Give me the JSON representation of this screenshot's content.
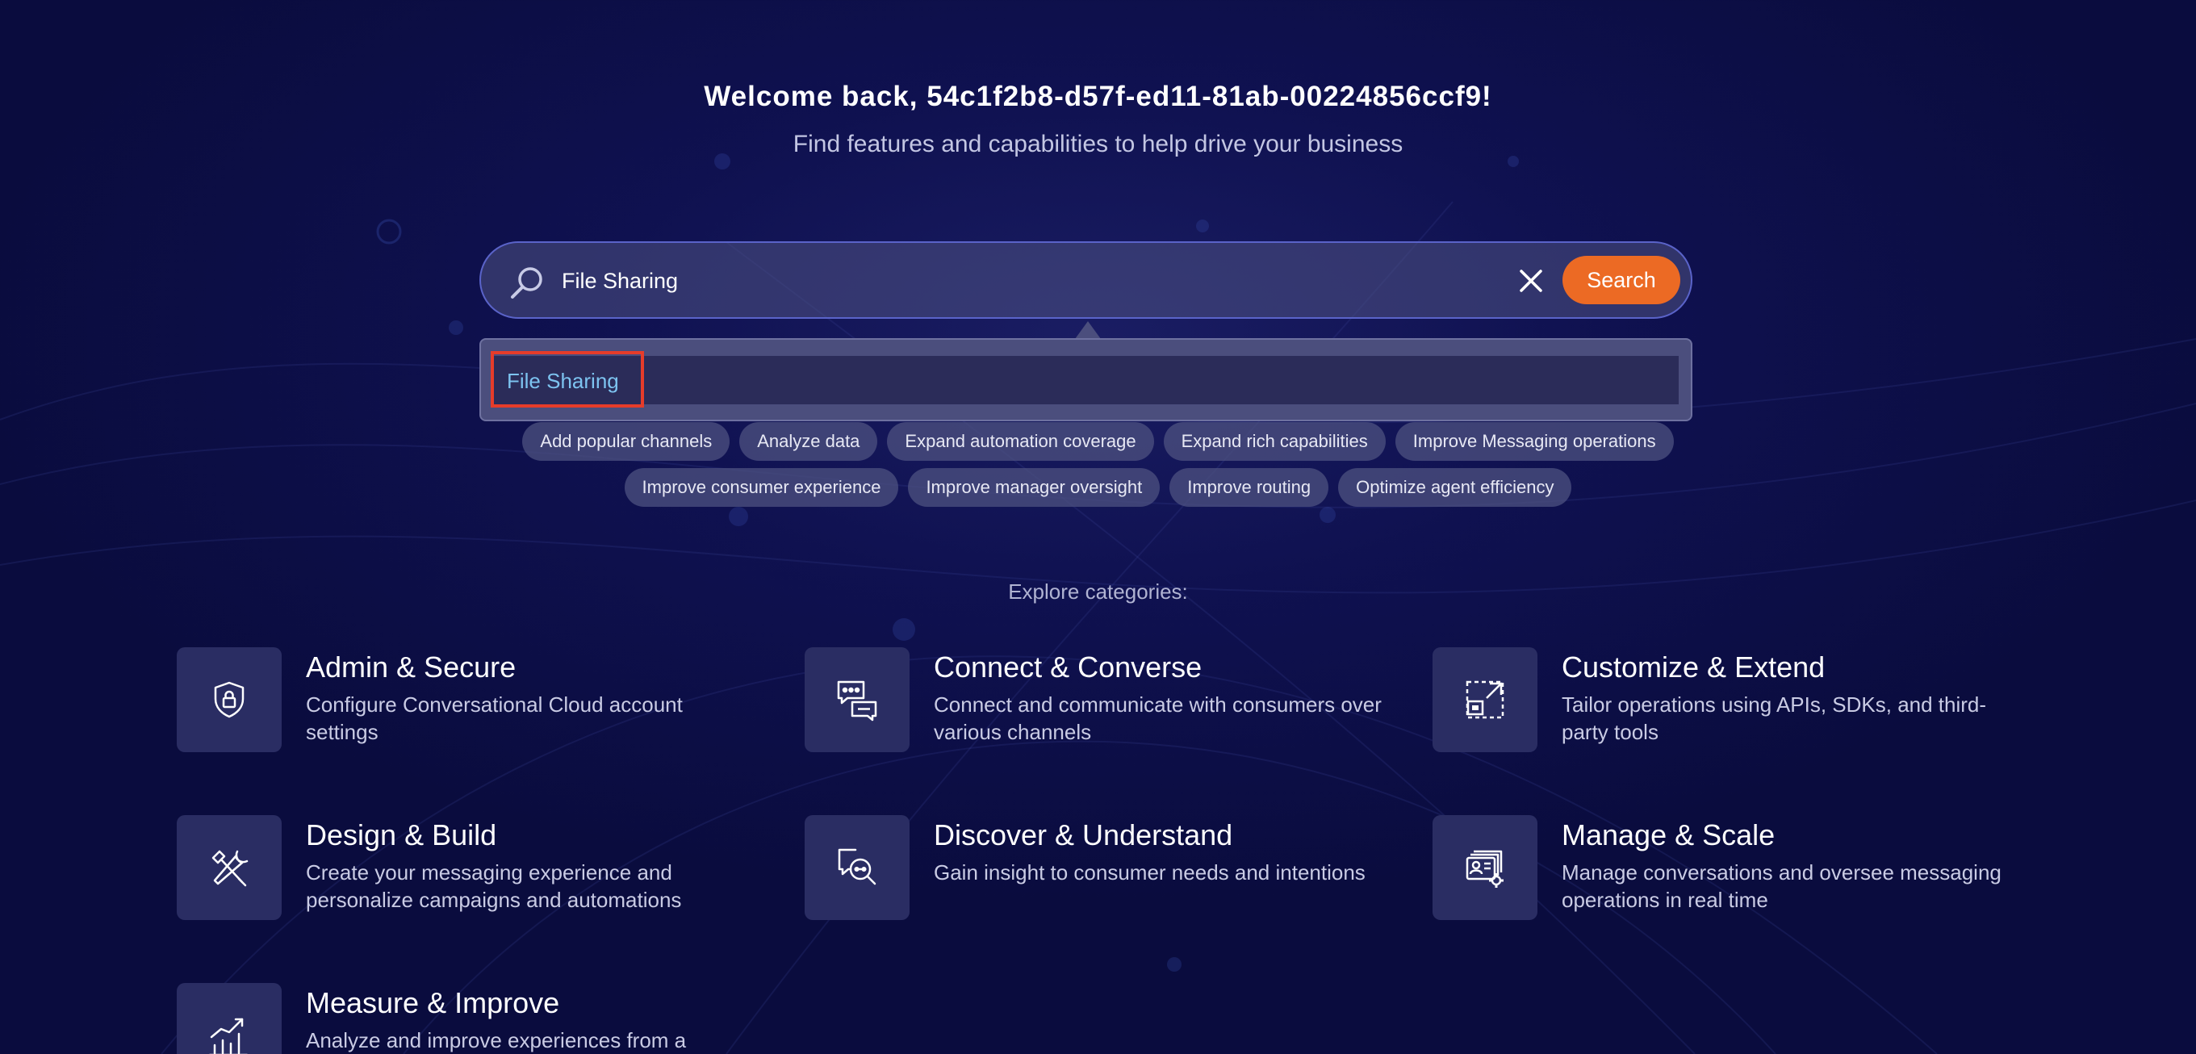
{
  "header": {
    "welcome": "Welcome back, 54c1f2b8-d57f-ed11-81ab-00224856ccf9!",
    "subtitle": "Find features and capabilities to help drive your business"
  },
  "search": {
    "value": "File Sharing",
    "button_label": "Search",
    "suggestions": [
      "File Sharing"
    ]
  },
  "chips": {
    "row1": [
      "Add popular channels",
      "Analyze data",
      "Expand automation coverage",
      "Expand rich capabilities",
      "Improve Messaging operations"
    ],
    "row2": [
      "Improve consumer experience",
      "Improve manager oversight",
      "Improve routing",
      "Optimize agent efficiency"
    ]
  },
  "explore_label": "Explore categories:",
  "categories": [
    {
      "title": "Admin & Secure",
      "description": "Configure Conversational Cloud account settings",
      "icon": "shield-lock-icon"
    },
    {
      "title": "Connect & Converse",
      "description": "Connect and communicate with consumers over various channels",
      "icon": "chat-bubbles-icon"
    },
    {
      "title": "Customize & Extend",
      "description": "Tailor operations using APIs, SDKs, and third-party tools",
      "icon": "expand-frame-icon"
    },
    {
      "title": "Design & Build",
      "description": "Create your messaging experience and personalize campaigns and automations",
      "icon": "tools-icon"
    },
    {
      "title": "Discover & Understand",
      "description": "Gain insight to consumer needs and intentions",
      "icon": "chat-search-icon"
    },
    {
      "title": "Manage & Scale",
      "description": "Manage conversations and oversee messaging operations in real time",
      "icon": "user-cards-gear-icon"
    },
    {
      "title": "Measure & Improve",
      "description": "Analyze and improve experiences from a",
      "icon": "bar-chart-trend-icon"
    }
  ],
  "colors": {
    "accent": "#ec6a24",
    "highlight": "#e63c2a",
    "suggestion_text": "#7dc3f0"
  }
}
